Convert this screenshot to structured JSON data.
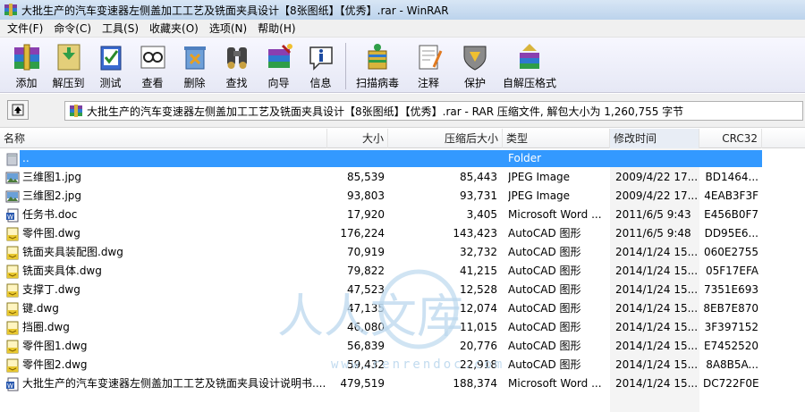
{
  "window": {
    "title": "大批生产的汽车变速器左侧盖加工工艺及铣面夹具设计【8张图纸】【优秀】.rar - WinRAR"
  },
  "menu": [
    {
      "label": "文件(F)"
    },
    {
      "label": "命令(C)"
    },
    {
      "label": "工具(S)"
    },
    {
      "label": "收藏夹(O)"
    },
    {
      "label": "选项(N)"
    },
    {
      "label": "帮助(H)"
    }
  ],
  "toolbar": [
    {
      "label": "添加",
      "icon": "add-archive-icon"
    },
    {
      "label": "解压到",
      "icon": "extract-to-icon"
    },
    {
      "label": "测试",
      "icon": "test-icon"
    },
    {
      "label": "查看",
      "icon": "view-icon"
    },
    {
      "label": "删除",
      "icon": "delete-icon"
    },
    {
      "label": "查找",
      "icon": "find-icon"
    },
    {
      "label": "向导",
      "icon": "wizard-icon"
    },
    {
      "label": "信息",
      "icon": "info-icon"
    },
    {
      "label": "扫描病毒",
      "icon": "virus-scan-icon"
    },
    {
      "label": "注释",
      "icon": "comment-icon"
    },
    {
      "label": "保护",
      "icon": "protect-icon"
    },
    {
      "label": "自解压格式",
      "icon": "sfx-icon"
    }
  ],
  "address": {
    "path": "大批生产的汽车变速器左侧盖加工工艺及铣面夹具设计【8张图纸】【优秀】.rar - RAR 压缩文件, 解包大小为 1,260,755 字节"
  },
  "columns": {
    "name": "名称",
    "size": "大小",
    "packed": "压缩后大小",
    "type": "类型",
    "modified": "修改时间",
    "crc": "CRC32"
  },
  "files": [
    {
      "name": "..",
      "size": "",
      "packed": "",
      "type": "Folder",
      "modified": "",
      "crc": "",
      "kind": "folder",
      "selected": true
    },
    {
      "name": "三维图1.jpg",
      "size": "85,539",
      "packed": "85,443",
      "type": "JPEG Image",
      "modified": "2009/4/22 17...",
      "crc": "BD1464...",
      "kind": "jpg"
    },
    {
      "name": "三维图2.jpg",
      "size": "93,803",
      "packed": "93,731",
      "type": "JPEG Image",
      "modified": "2009/4/22 17...",
      "crc": "4EAB3F3F",
      "kind": "jpg"
    },
    {
      "name": "任务书.doc",
      "size": "17,920",
      "packed": "3,405",
      "type": "Microsoft Word ...",
      "modified": "2011/6/5 9:43",
      "crc": "E456B0F7",
      "kind": "doc"
    },
    {
      "name": "零件图.dwg",
      "size": "176,224",
      "packed": "143,423",
      "type": "AutoCAD 图形",
      "modified": "2011/6/5 9:48",
      "crc": "DD95E6...",
      "kind": "dwg"
    },
    {
      "name": "铣面夹具装配图.dwg",
      "size": "70,919",
      "packed": "32,732",
      "type": "AutoCAD 图形",
      "modified": "2014/1/24 15...",
      "crc": "060E2755",
      "kind": "dwg"
    },
    {
      "name": "铣面夹具体.dwg",
      "size": "79,822",
      "packed": "41,215",
      "type": "AutoCAD 图形",
      "modified": "2014/1/24 15...",
      "crc": "05F17EFA",
      "kind": "dwg"
    },
    {
      "name": "支撑丁.dwg",
      "size": "47,523",
      "packed": "12,528",
      "type": "AutoCAD 图形",
      "modified": "2014/1/24 15...",
      "crc": "7351E693",
      "kind": "dwg"
    },
    {
      "name": "键.dwg",
      "size": "47,135",
      "packed": "12,074",
      "type": "AutoCAD 图形",
      "modified": "2014/1/24 15...",
      "crc": "8EB7E870",
      "kind": "dwg"
    },
    {
      "name": "挡圈.dwg",
      "size": "46,080",
      "packed": "11,015",
      "type": "AutoCAD 图形",
      "modified": "2014/1/24 15...",
      "crc": "3F397152",
      "kind": "dwg"
    },
    {
      "name": "零件图1.dwg",
      "size": "56,839",
      "packed": "20,776",
      "type": "AutoCAD 图形",
      "modified": "2014/1/24 15...",
      "crc": "E7452520",
      "kind": "dwg"
    },
    {
      "name": "零件图2.dwg",
      "size": "59,432",
      "packed": "22,918",
      "type": "AutoCAD 图形",
      "modified": "2014/1/24 15...",
      "crc": "8A8B5A...",
      "kind": "dwg"
    },
    {
      "name": "大批生产的汽车变速器左侧盖加工工艺及铣面夹具设计说明书....",
      "size": "479,519",
      "packed": "188,374",
      "type": "Microsoft Word ...",
      "modified": "2014/1/24 15...",
      "crc": "DC722F0E",
      "kind": "doc"
    }
  ],
  "watermark": {
    "text": "人人文库",
    "url": "www.renrendoc.com"
  },
  "colors": {
    "selection": "#3399ff",
    "toolbar_bg": "#e6e8f5",
    "watermark": "#bcd8ee"
  }
}
